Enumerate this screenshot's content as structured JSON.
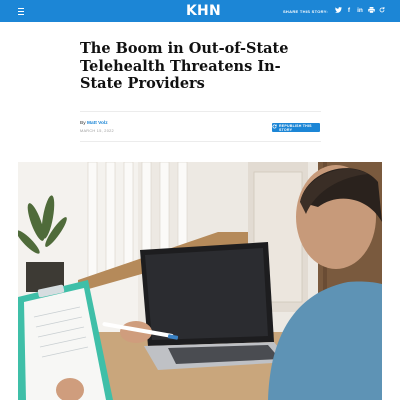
{
  "header": {
    "logo": "KHN",
    "share_label": "SHARE THIS STORY:",
    "share_icons": [
      "twitter-icon",
      "facebook-icon",
      "linkedin-icon",
      "print-icon",
      "republish-icon"
    ],
    "accent_color": "#1c86d6"
  },
  "article": {
    "title": "The Boom in Out-of-State Telehealth Threatens In-State Providers",
    "by_prefix": "By",
    "author": "Matt Volz",
    "date": "MARCH 15, 2022",
    "republish_label": "REPUBLISH THIS STORY"
  },
  "hero": {
    "icon": "telehealth-photo"
  }
}
